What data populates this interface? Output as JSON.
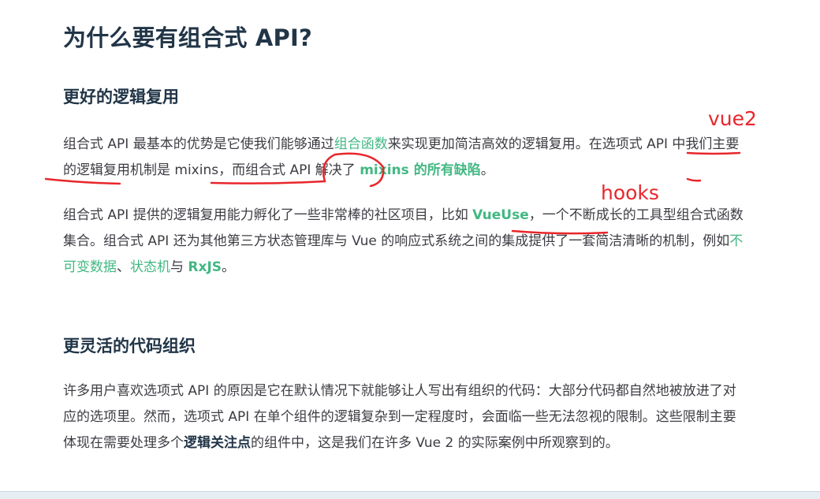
{
  "title": "为什么要有组合式 API?",
  "section1": {
    "heading": "更好的逻辑复用",
    "para1": {
      "t1": "组合式 API 最基本的优势是它使我们能够通过",
      "link_composables": "组合函数",
      "t2": "来实现更加简洁高效的逻辑复用。在选项式 API 中我们主要的逻辑复用机制是 mixins，而组合式 API 解决了 ",
      "link_mixins": "mixins 的所有缺陷",
      "t3": "。"
    },
    "para2": {
      "t1": "组合式 API 提供的逻辑复用能力孵化了一些非常棒的社区项目，比如 ",
      "link_vueuse": "VueUse",
      "t2": "，一个不断成长的工具型组合式函数集合。组合式 API 还为其他第三方状态管理库与 Vue 的响应式系统之间的集成提供了一套简洁清晰的机制，例如",
      "link_immutable": "不可变数据",
      "sep": "、",
      "link_state_machine": "状态机",
      "t3": "与 ",
      "link_rxjs": "RxJS",
      "t4": "。"
    }
  },
  "section2": {
    "heading": "更灵活的代码组织",
    "para": {
      "t1": "许多用户喜欢选项式 API 的原因是它在默认情况下就能够让人写出有组织的代码：大部分代码都自然地被放进了对应的选项里。然而，选项式 API 在单个组件的逻辑复杂到一定程度时，会面临一些无法忽视的限制。这些限制主要体现在需要处理多个",
      "bold_concerns": "逻辑关注点",
      "t2": "的组件中，这是我们在许多 Vue 2 的实际案例中所观察到的。"
    }
  },
  "annotations": {
    "note_vue2": "vue2",
    "note_hooks": "hooks",
    "color": "#e8262b"
  },
  "colors": {
    "heading": "#213547",
    "text": "#3c3c43",
    "link": "#42b883"
  }
}
